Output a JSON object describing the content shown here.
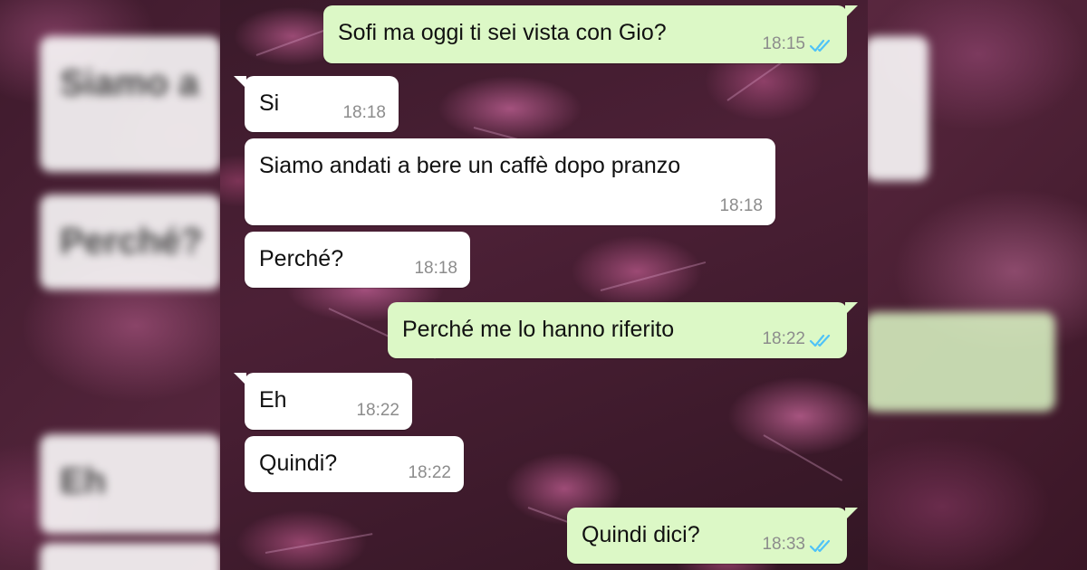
{
  "colors": {
    "incoming_bubble": "#ffffff",
    "outgoing_bubble": "#dcf8c6",
    "timestamp": "#8c8c8c",
    "read_ticks": "#4fc3f7",
    "background": "#4a2034"
  },
  "read_indicator_icon": "double-check-icon",
  "messages": [
    {
      "direction": "outgoing",
      "text": "Sofi ma oggi ti sei vista con Gio?",
      "time": "18:15",
      "read": true
    },
    {
      "direction": "incoming",
      "text": "Si",
      "time": "18:18"
    },
    {
      "direction": "incoming",
      "text": "Siamo andati a bere un caffè dopo pranzo",
      "time": "18:18"
    },
    {
      "direction": "incoming",
      "text": "Perché?",
      "time": "18:18"
    },
    {
      "direction": "outgoing",
      "text": "Perché me lo hanno riferito",
      "time": "18:22",
      "read": true
    },
    {
      "direction": "incoming",
      "text": "Eh",
      "time": "18:22"
    },
    {
      "direction": "incoming",
      "text": "Quindi?",
      "time": "18:22"
    },
    {
      "direction": "outgoing",
      "text": "Quindi dici?",
      "time": "18:33",
      "read": true
    }
  ]
}
